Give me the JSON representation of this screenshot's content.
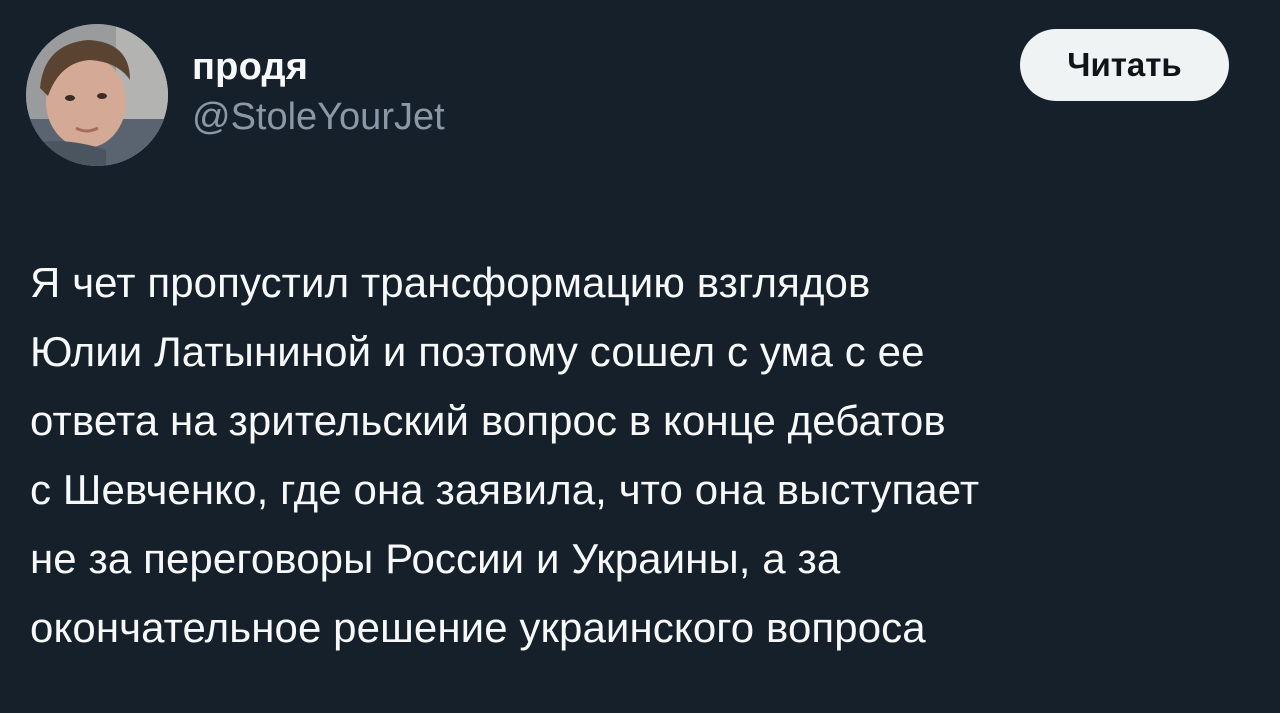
{
  "author": {
    "display_name": "продя",
    "handle": "@StoleYourJet"
  },
  "follow_button": {
    "label": "Читать"
  },
  "tweet": {
    "lines": [
      "Я чет пропустил трансформацию взглядов",
      "Юлии Латыниной и поэтому сошел с ума с ее",
      "ответа на зрительский вопрос в конце дебатов",
      "с Шевченко, где она заявила, что она выступает",
      "не за переговоры России и Украины, а за",
      "окончательное решение украинского вопроса"
    ]
  },
  "colors": {
    "background": "#15202b",
    "primary_text": "#f7f9f9",
    "secondary_text": "#8b98a5",
    "button_bg": "#eff3f4",
    "button_text": "#0f1419"
  }
}
